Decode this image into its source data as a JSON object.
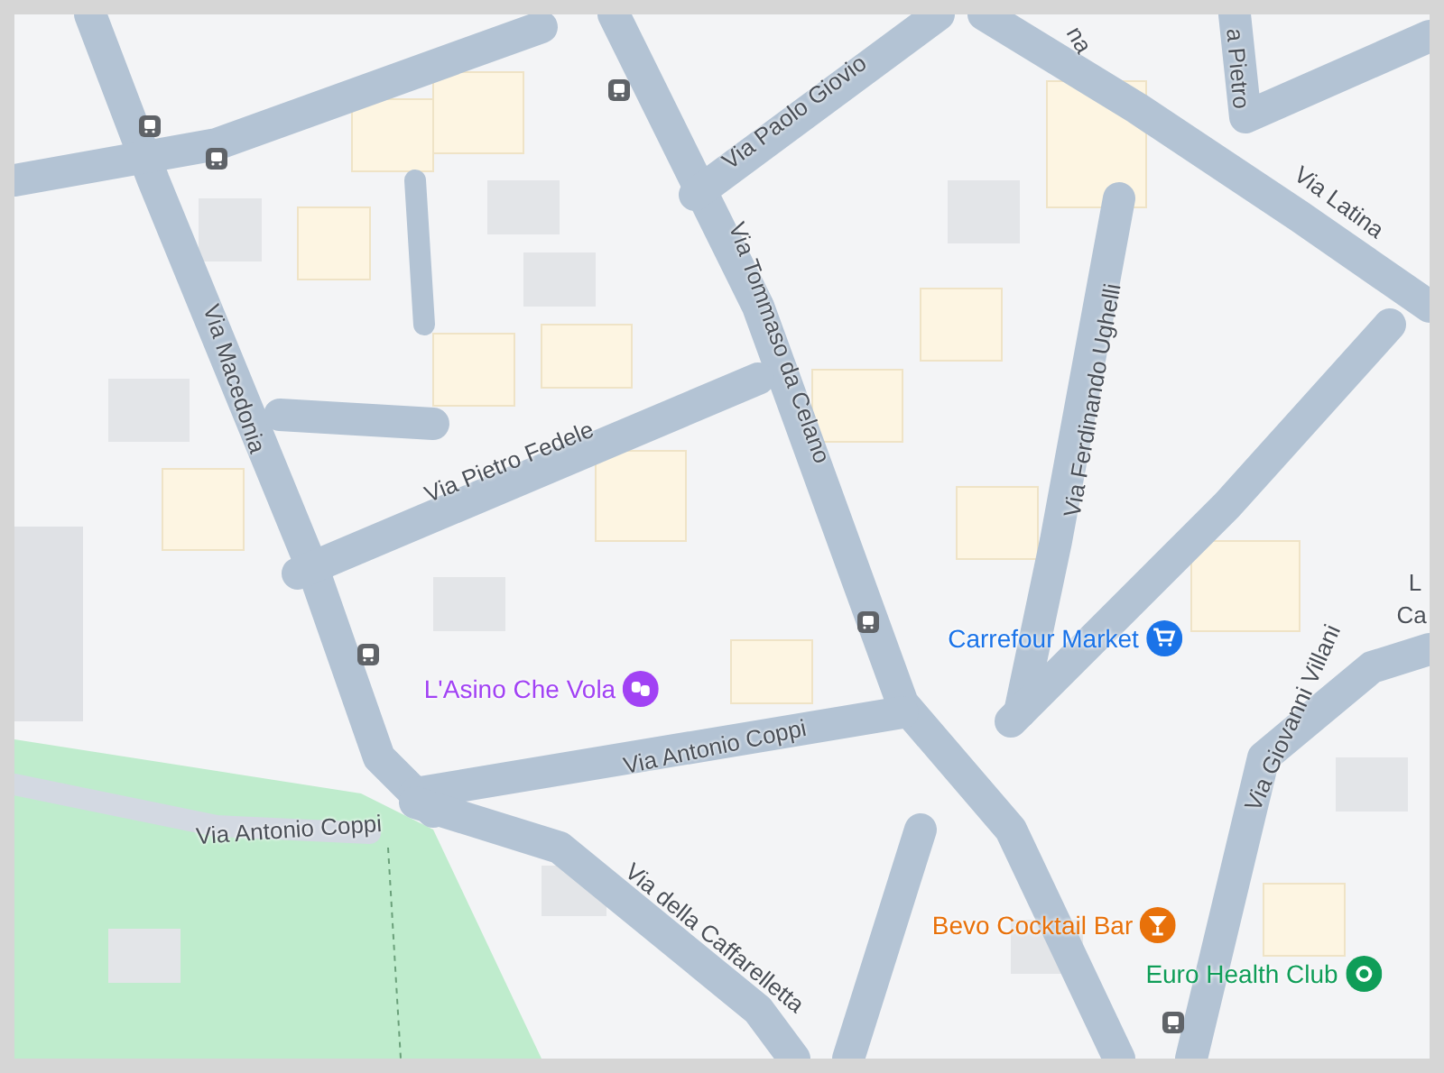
{
  "map": {
    "streets": [
      {
        "name": "Via Macedonia"
      },
      {
        "name": "Via Pietro Fedele"
      },
      {
        "name": "Via Tommaso da Celano"
      },
      {
        "name": "Via Paolo Giovio"
      },
      {
        "name": "Via Ferdinando Ughelli"
      },
      {
        "name": "Via Latina"
      },
      {
        "name": "a Pietro"
      },
      {
        "name": "na"
      },
      {
        "name": "Via Antonio Coppi"
      },
      {
        "name": "Via Antonio Coppi"
      },
      {
        "name": "Via della Caffarelletta"
      },
      {
        "name": "Via Giovanni Villani"
      },
      {
        "name": "L"
      },
      {
        "name": "Ca"
      }
    ],
    "places": [
      {
        "name": "L'Asino Che Vola",
        "kind": "theater",
        "color": "#a142f4"
      },
      {
        "name": "Carrefour Market",
        "kind": "shop",
        "color": "#1a73e8"
      },
      {
        "name": "Bevo Cocktail Bar",
        "kind": "bar",
        "color": "#e8710a"
      },
      {
        "name": "Euro Health Club",
        "kind": "gym",
        "color": "#0f9d58"
      }
    ]
  }
}
